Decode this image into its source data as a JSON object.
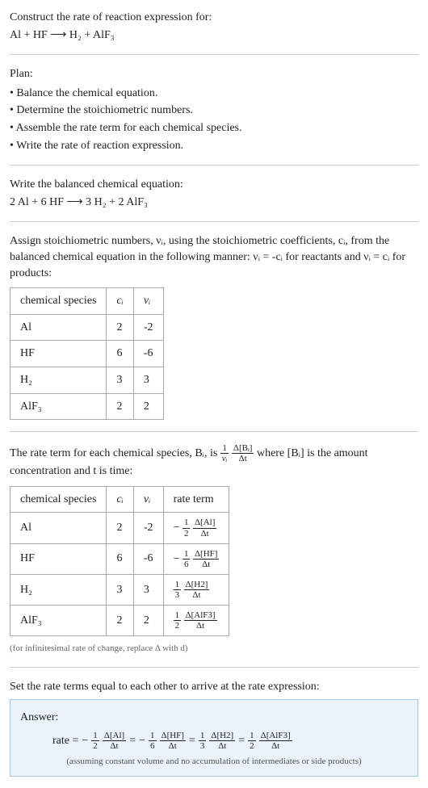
{
  "q_line1": "Construct the rate of reaction expression for:",
  "q_line2": "Al + HF ⟶ H₂ + AlF₃",
  "plan_title": "Plan:",
  "plan_items": [
    "• Balance the chemical equation.",
    "• Determine the stoichiometric numbers.",
    "• Assemble the rate term for each chemical species.",
    "• Write the rate of reaction expression."
  ],
  "balanced_title": "Write the balanced chemical equation:",
  "balanced_eq": "2 Al + 6 HF ⟶ 3 H₂ + 2 AlF₃",
  "stoich_intro": "Assign stoichiometric numbers, νᵢ, using the stoichiometric coefficients, cᵢ, from the balanced chemical equation in the following manner: νᵢ = -cᵢ for reactants and νᵢ = cᵢ for products:",
  "table1": {
    "headers": [
      "chemical species",
      "cᵢ",
      "νᵢ"
    ],
    "rows": [
      {
        "sp": "Al",
        "c": "2",
        "v": "-2"
      },
      {
        "sp": "HF",
        "c": "6",
        "v": "-6"
      },
      {
        "sp": "H₂",
        "c": "3",
        "v": "3"
      },
      {
        "sp": "AlF₃",
        "c": "2",
        "v": "2"
      }
    ]
  },
  "rate_intro_pre": "The rate term for each chemical species, Bᵢ, is ",
  "rate_intro_frac1_num": "1",
  "rate_intro_frac1_den": "νᵢ",
  "rate_intro_frac2_num": "Δ[Bᵢ]",
  "rate_intro_frac2_den": "Δt",
  "rate_intro_post": " where [Bᵢ] is the amount concentration and t is time:",
  "table2": {
    "headers": [
      "chemical species",
      "cᵢ",
      "νᵢ",
      "rate term"
    ],
    "rows": [
      {
        "sp": "Al",
        "c": "2",
        "v": "-2",
        "sign": "−",
        "coef_num": "1",
        "coef_den": "2",
        "d_num": "Δ[Al]",
        "d_den": "Δt"
      },
      {
        "sp": "HF",
        "c": "6",
        "v": "-6",
        "sign": "−",
        "coef_num": "1",
        "coef_den": "6",
        "d_num": "Δ[HF]",
        "d_den": "Δt"
      },
      {
        "sp": "H₂",
        "c": "3",
        "v": "3",
        "sign": "",
        "coef_num": "1",
        "coef_den": "3",
        "d_num": "Δ[H2]",
        "d_den": "Δt"
      },
      {
        "sp": "AlF₃",
        "c": "2",
        "v": "2",
        "sign": "",
        "coef_num": "1",
        "coef_den": "2",
        "d_num": "Δ[AlF3]",
        "d_den": "Δt"
      }
    ]
  },
  "infinitesimal_note": "(for infinitesimal rate of change, replace Δ with d)",
  "final_intro": "Set the rate terms equal to each other to arrive at the rate expression:",
  "answer_label": "Answer:",
  "answer_rate_label": "rate = ",
  "answer_terms": [
    {
      "sign": "−",
      "coef_num": "1",
      "coef_den": "2",
      "d_num": "Δ[Al]",
      "d_den": "Δt"
    },
    {
      "sign": "−",
      "coef_num": "1",
      "coef_den": "6",
      "d_num": "Δ[HF]",
      "d_den": "Δt"
    },
    {
      "sign": "",
      "coef_num": "1",
      "coef_den": "3",
      "d_num": "Δ[H2]",
      "d_den": "Δt"
    },
    {
      "sign": "",
      "coef_num": "1",
      "coef_den": "2",
      "d_num": "Δ[AlF3]",
      "d_den": "Δt"
    }
  ],
  "answer_note": "(assuming constant volume and no accumulation of intermediates or side products)"
}
